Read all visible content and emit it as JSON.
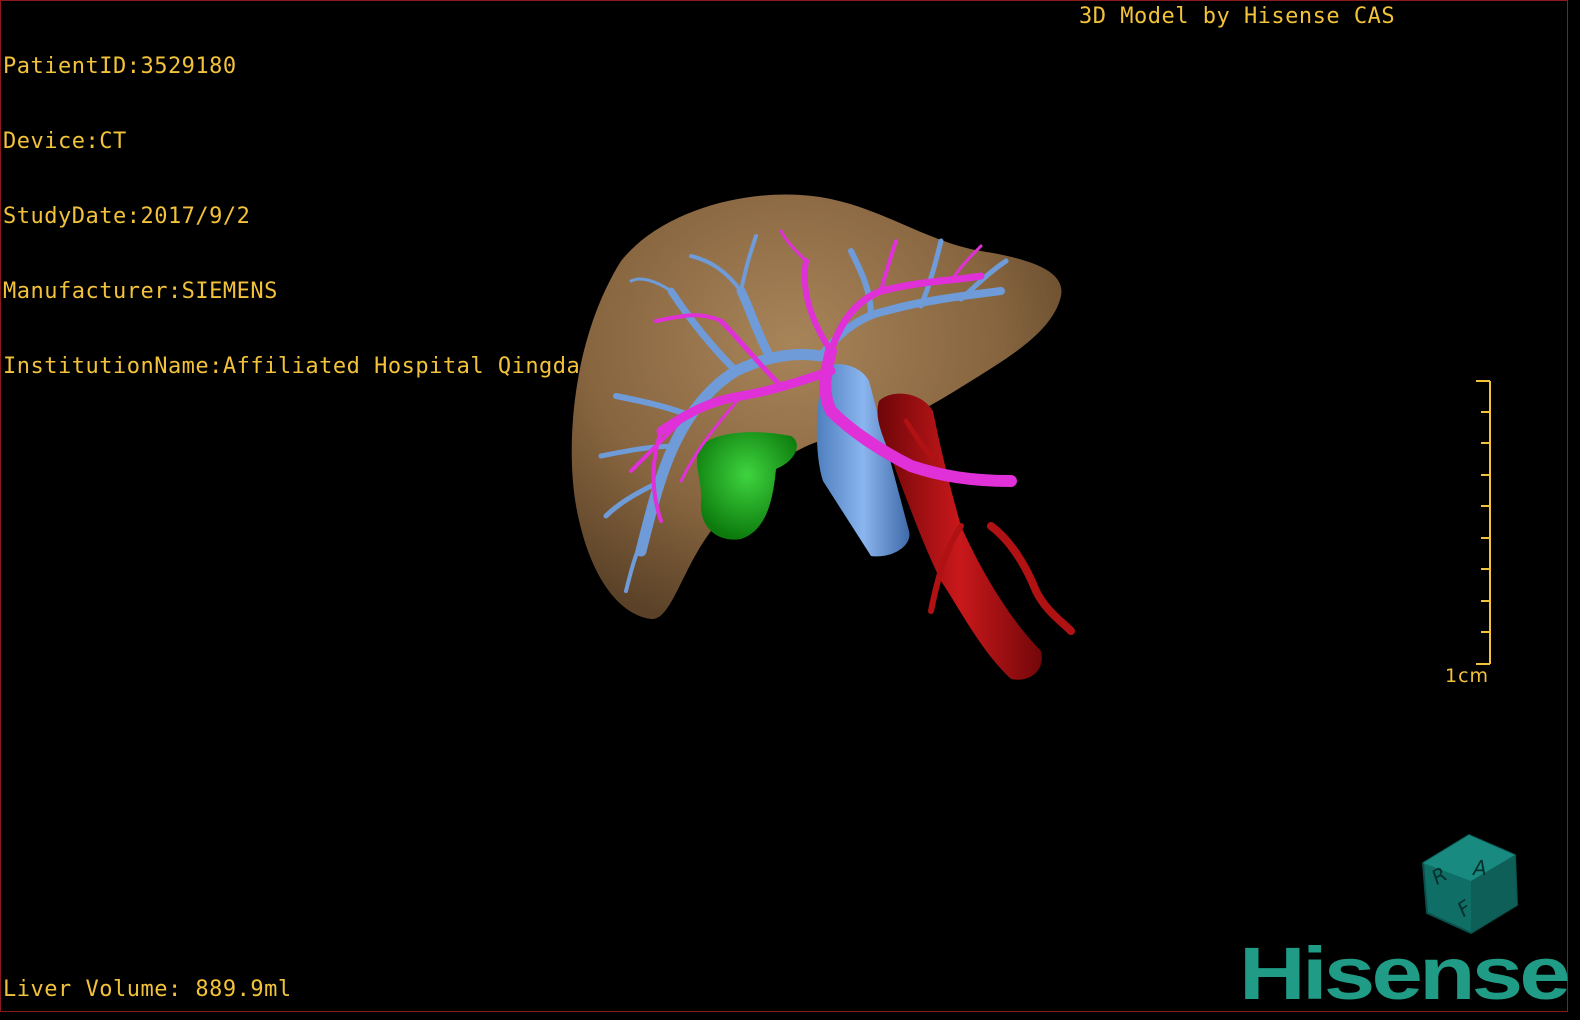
{
  "info": {
    "patient_id": "PatientID:3529180",
    "device": "Device:CT",
    "study_date": "StudyDate:2017/9/2",
    "manufacturer": "Manufacturer:SIEMENS",
    "institution": "InstitutionName:Affiliated Hospital Qingdao University-C"
  },
  "brand_caption": "3D Model by Hisense CAS",
  "liver_volume": "Liver Volume: 889.9ml",
  "scale": {
    "label": "1cm"
  },
  "orientation_cube": {
    "face_letters": [
      "R",
      "A",
      "F"
    ],
    "icon": "orientation-cube-icon"
  },
  "logo": {
    "text": "Hisense",
    "color": "#1f9b86"
  },
  "colors": {
    "text": "#f2c23a",
    "liver": "#8a6a47",
    "portal_vein": "#6f9bd8",
    "hepatic_artery": "#e030d8",
    "gallbladder": "#1fa01f",
    "vena_cava": "#6b9ee0",
    "aorta": "#a90f12",
    "frame": "#8b1a1a"
  }
}
